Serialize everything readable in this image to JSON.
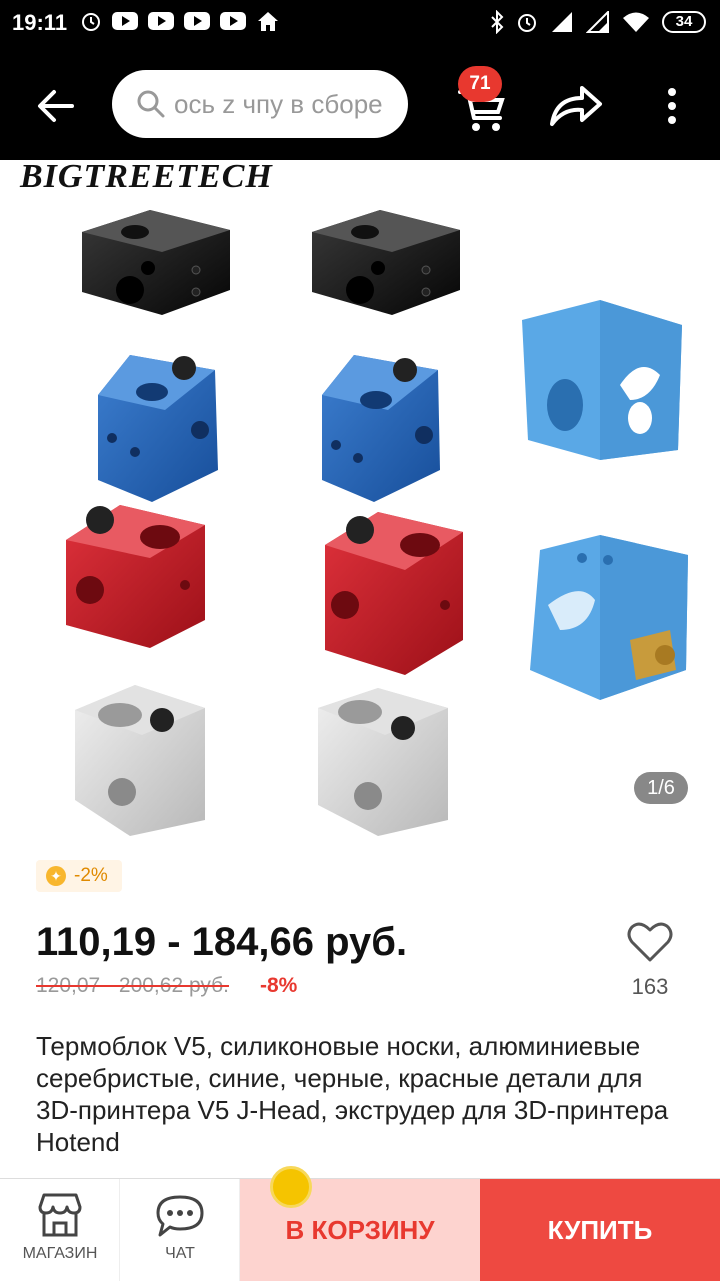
{
  "statusbar": {
    "time": "19:11",
    "battery": "34"
  },
  "search": {
    "text": "ось z чпу в сборе"
  },
  "cart": {
    "badge": "71"
  },
  "gallery": {
    "brand": "BIGTREETECH",
    "pager": "1/6"
  },
  "coupon": {
    "text": "-2%"
  },
  "product": {
    "price": "110,19 - 184,66 руб.",
    "old_price": "120,07 - 200,62 руб.",
    "discount": "-8%",
    "favorites": "163",
    "title": "Термоблок V5, силиконовые носки, алюминиевые серебристые, синие, черные, красные детали для 3D-принтера V5 J-Head, экструдер для 3D-принтера Hotend"
  },
  "bottombar": {
    "store_label": "МАГАЗИН",
    "chat_label": "ЧАТ",
    "add_to_cart": "В КОРЗИНУ",
    "buy": "КУПИТЬ"
  },
  "colors": {
    "accent": "#ee4941",
    "cart_bg": "#fdd3cf",
    "coupon": "#e08a00"
  }
}
